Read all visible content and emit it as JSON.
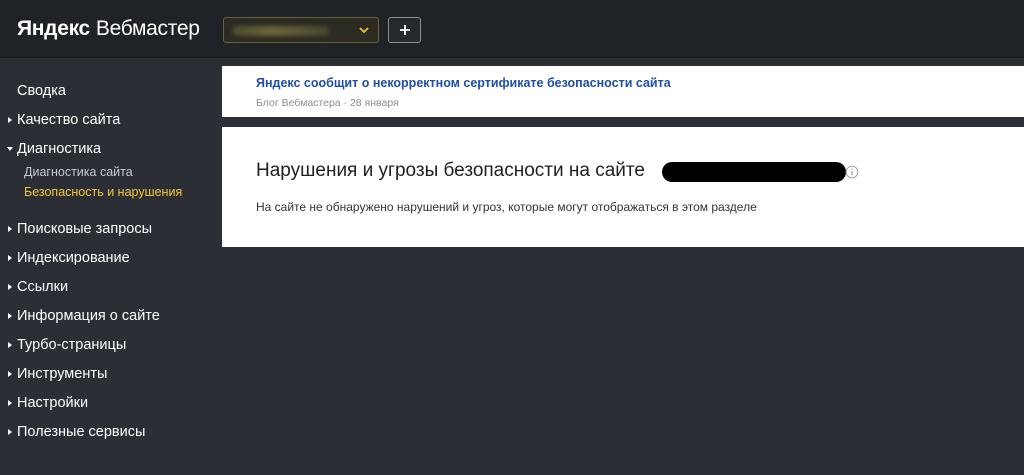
{
  "header": {
    "logo_brand": "Яндекс",
    "logo_product": "Вебмастер",
    "site_selector_value": "",
    "add_site_label": "+"
  },
  "sidebar": {
    "items": [
      {
        "label": "Сводка",
        "arrow": "none"
      },
      {
        "label": "Качество сайта",
        "arrow": "right"
      },
      {
        "label": "Диагностика",
        "arrow": "down"
      },
      {
        "label": "Поисковые запросы",
        "arrow": "right"
      },
      {
        "label": "Индексирование",
        "arrow": "right"
      },
      {
        "label": "Ссылки",
        "arrow": "right"
      },
      {
        "label": "Информация о сайте",
        "arrow": "right"
      },
      {
        "label": "Турбо-страницы",
        "arrow": "right"
      },
      {
        "label": "Инструменты",
        "arrow": "right"
      },
      {
        "label": "Настройки",
        "arrow": "right"
      },
      {
        "label": "Полезные сервисы",
        "arrow": "right"
      }
    ],
    "diagnostics_sub": [
      {
        "label": "Диагностика сайта",
        "active": false
      },
      {
        "label": "Безопасность и нарушения",
        "active": true
      }
    ]
  },
  "news": {
    "link_text": "Яндекс сообщит о некорректном сертификате безопасности сайта",
    "meta": "Блог Вебмастера · 28 января"
  },
  "main": {
    "title": "Нарушения и угрозы безопасности на сайте",
    "message": "На сайте не обнаружено нарушений и угроз, которые могут отображаться в этом разделе"
  },
  "colors": {
    "accent": "#f7c63a",
    "link": "#1f4ea8",
    "background": "#2b2f35",
    "header": "#1f2226"
  },
  "icons": [
    "chevron-down-icon",
    "plus-icon",
    "arrow-right-icon",
    "arrow-down-icon",
    "info-icon"
  ]
}
